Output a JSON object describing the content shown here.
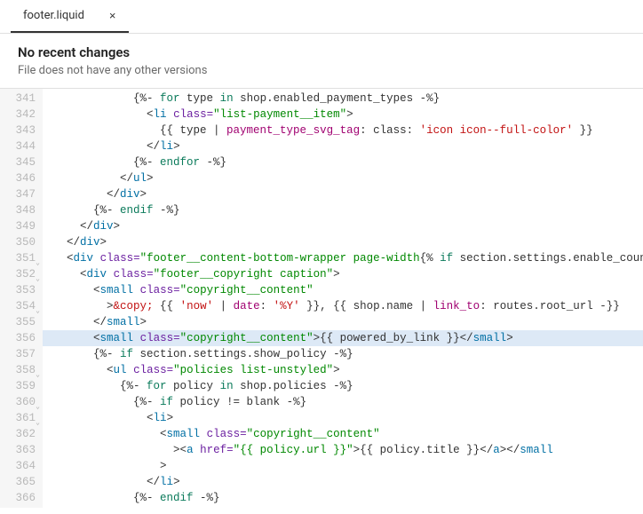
{
  "tab": {
    "filename": "footer.liquid",
    "close": "×"
  },
  "header": {
    "title": "No recent changes",
    "subtitle": "File does not have any other versions"
  },
  "gutter": {
    "start": 341,
    "end": 366,
    "folds": [
      351,
      352,
      354,
      358,
      360,
      361
    ]
  },
  "code": {
    "l341": {
      "indent": "            ",
      "open": "{%- ",
      "kw": "for",
      "rest": " type ",
      "in": "in",
      "rest2": " shop.enabled_payment_types -%}"
    },
    "l342": {
      "indent": "              ",
      "lt": "<",
      "tag": "li",
      "sp": " ",
      "attr": "class=",
      "str": "\"list-payment__item\"",
      "gt": ">"
    },
    "l343": {
      "indent": "                ",
      "open": "{{ type | ",
      "filter": "payment_type_svg_tag",
      "mid": ": class: ",
      "val": "'icon icon--full-color'",
      "close": " }}"
    },
    "l344": {
      "indent": "              ",
      "lt": "</",
      "tag": "li",
      "gt": ">"
    },
    "l345": {
      "indent": "            ",
      "open": "{%- ",
      "kw": "endfor",
      "close": " -%}"
    },
    "l346": {
      "indent": "          ",
      "lt": "</",
      "tag": "ul",
      "gt": ">"
    },
    "l347": {
      "indent": "        ",
      "lt": "</",
      "tag": "div",
      "gt": ">"
    },
    "l348": {
      "indent": "      ",
      "open": "{%- ",
      "kw": "endif",
      "close": " -%}"
    },
    "l349": {
      "indent": "    ",
      "lt": "</",
      "tag": "div",
      "gt": ">"
    },
    "l350": {
      "indent": "  ",
      "lt": "</",
      "tag": "div",
      "gt": ">"
    },
    "l351": {
      "indent": "  ",
      "lt": "<",
      "tag": "div",
      "sp": " ",
      "attr": "class=",
      "strstart": "\"footer__content-bottom-wrapper page-width",
      "liq": "{% ",
      "kw": "if",
      "rest": " section.settings.enable_country"
    },
    "l352": {
      "indent": "    ",
      "lt": "<",
      "tag": "div",
      "sp": " ",
      "attr": "class=",
      "str": "\"footer__copyright caption\"",
      "gt": ">"
    },
    "l353": {
      "indent": "      ",
      "lt": "<",
      "tag": "small",
      "sp": " ",
      "attr": "class=",
      "str": "\"copyright__content\"",
      "gt": ""
    },
    "l354": {
      "indent": "        ",
      "gt0": ">",
      "ent": "&copy;",
      "open": " {{ ",
      "var1": "'now'",
      "pipe1": " | ",
      "filt1": "date",
      "arg1": ": ",
      "val1": "'%Y'",
      "close1": " }}, {{ shop.name | ",
      "filt2": "link_to",
      "arg2": ": routes.root_url -}}"
    },
    "l355": {
      "indent": "      ",
      "lt": "</",
      "tag": "small",
      "gt": ">"
    },
    "l356": {
      "indent": "      ",
      "lt": "<",
      "tag": "small",
      "sp": " ",
      "attr": "class=",
      "str": "\"copyright__content\"",
      "gt": ">",
      "liq": "{{ powered_by_link }}",
      "lt2": "</",
      "tag2": "small",
      "gt2": ">"
    },
    "l357": {
      "indent": "      ",
      "open": "{%- ",
      "kw": "if",
      "rest": " section.settings.show_policy -%}"
    },
    "l358": {
      "indent": "        ",
      "lt": "<",
      "tag": "ul",
      "sp": " ",
      "attr": "class=",
      "str": "\"policies list-unstyled\"",
      "gt": ">"
    },
    "l359": {
      "indent": "          ",
      "open": "{%- ",
      "kw": "for",
      "rest": " policy ",
      "in": "in",
      "rest2": " shop.policies -%}"
    },
    "l360": {
      "indent": "            ",
      "open": "{%- ",
      "kw": "if",
      "rest": " policy != blank -%}"
    },
    "l361": {
      "indent": "              ",
      "lt": "<",
      "tag": "li",
      "gt": ">"
    },
    "l362": {
      "indent": "                ",
      "lt": "<",
      "tag": "small",
      "sp": " ",
      "attr": "class=",
      "str": "\"copyright__content\"",
      "gt": ""
    },
    "l363": {
      "indent": "                  ",
      "gt0": ">",
      "lt": "<",
      "tag": "a",
      "sp": " ",
      "attr": "href=",
      "str": "\"{{ policy.url }}\"",
      "gt": ">",
      "liq": "{{ policy.title }}",
      "lt2": "</",
      "tag2": "a",
      "gt2": "></",
      "tag3": "small",
      "gt3": ""
    },
    "l364": {
      "indent": "                ",
      "gt0": ">"
    },
    "l365": {
      "indent": "              ",
      "lt": "</",
      "tag": "li",
      "gt": ">"
    },
    "l366": {
      "indent": "            ",
      "open": "{%- ",
      "kw": "endif",
      "close": " -%}"
    }
  }
}
